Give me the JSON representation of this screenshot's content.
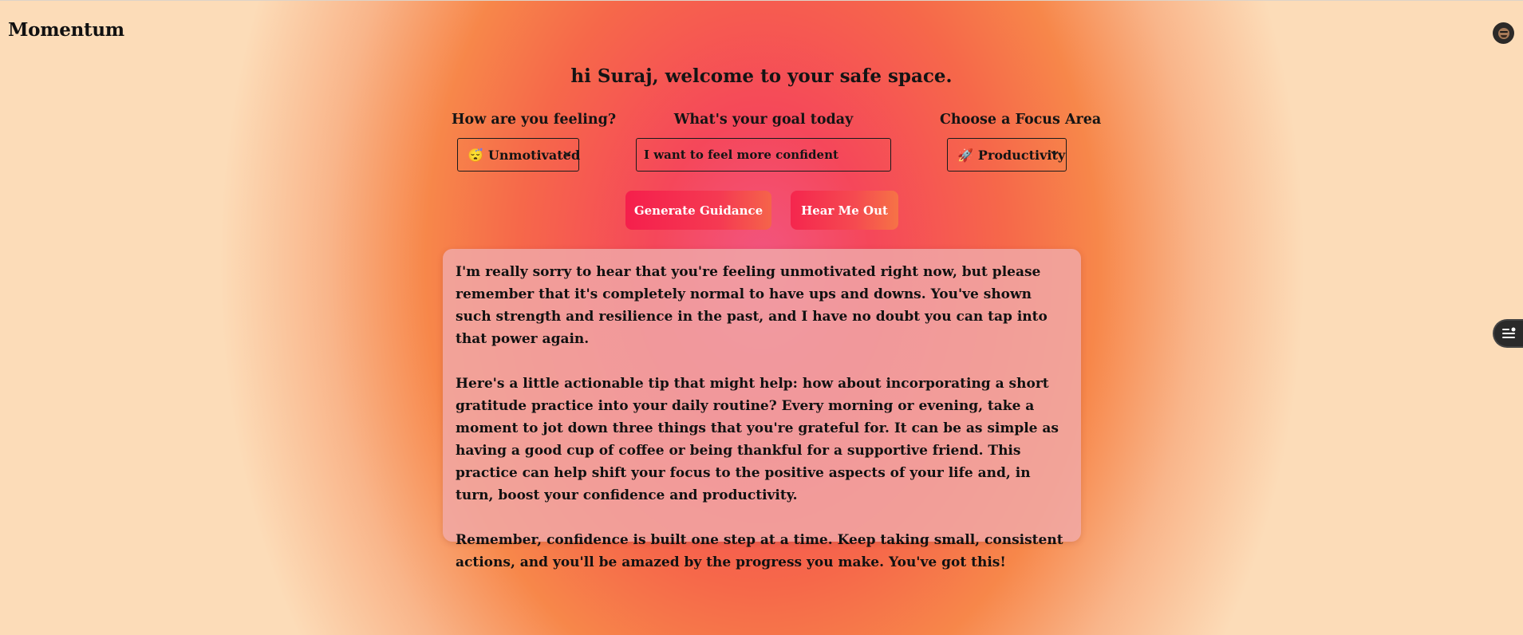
{
  "app": {
    "title": "Momentum"
  },
  "header": {
    "greeting": "hi Suraj, welcome to your safe space."
  },
  "form": {
    "mood": {
      "label": "How are you feeling?",
      "emoji": "😴",
      "value": "Unmotivated"
    },
    "goal": {
      "label": "What's your goal today",
      "value": "I want to feel more confident"
    },
    "focus": {
      "label": "Choose a Focus Area",
      "emoji": "🚀",
      "value": "Productivity"
    }
  },
  "actions": {
    "generate_label": "Generate Guidance",
    "hear_label": "Hear Me Out"
  },
  "response": {
    "paragraphs": [
      "I'm really sorry to hear that you're feeling unmotivated right now, but please remember that it's completely normal to have ups and downs. You've shown such strength and resilience in the past, and I have no doubt you can tap into that power again.",
      "Here's a little actionable tip that might help: how about incorporating a short gratitude practice into your daily routine? Every morning or evening, take a moment to jot down three things that you're grateful for. It can be as simple as having a good cup of coffee or being thankful for a supportive friend. This practice can help shift your focus to the positive aspects of your life and, in turn, boost your confidence and productivity.",
      "Remember, confidence is built one step at a time. Keep taking small, consistent actions, and you'll be amazed by the progress you make. You've got this!"
    ]
  },
  "icons": {
    "avatar": "user-avatar",
    "side": "menu-lines-icon",
    "chevron": "chevron-down-icon"
  },
  "colors": {
    "primary_button": "#f51f4c",
    "accent_orange": "#f6684a"
  }
}
